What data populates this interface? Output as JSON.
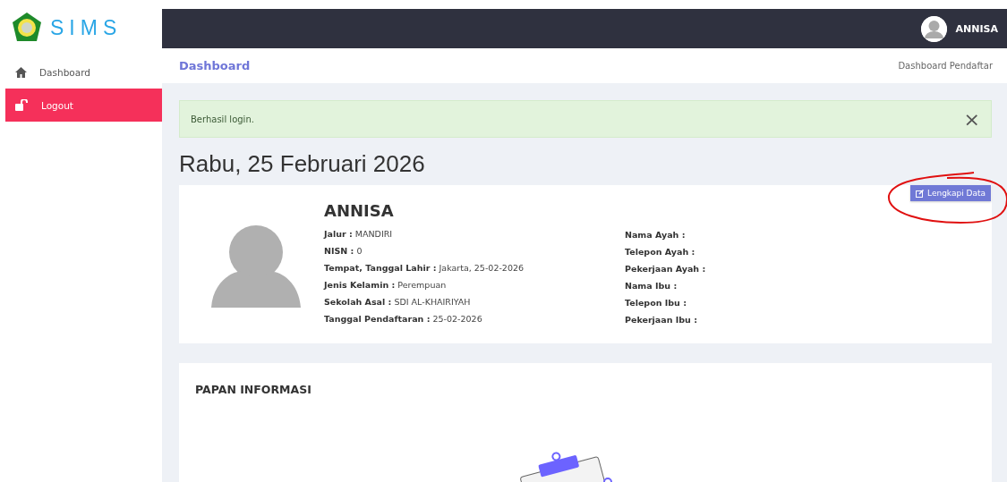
{
  "sidebar": {
    "brand": "SIMS",
    "items": [
      {
        "label": "Dashboard",
        "selected": false
      },
      {
        "label": "Logout",
        "selected": true
      }
    ]
  },
  "topbar": {
    "user": "ANNISA"
  },
  "breadcrumb": {
    "title": "Dashboard",
    "trail": "Dashboard Pendaftar"
  },
  "alert": {
    "message": "Berhasil login.",
    "close": "×"
  },
  "date_heading": "Rabu, 25 Februari 2026",
  "profile": {
    "name": "ANNISA",
    "button": "Lengkapi Data",
    "left_fields": [
      {
        "label": "Jalur :",
        "value": "MANDIRI"
      },
      {
        "label": "NISN :",
        "value": "0"
      },
      {
        "label": "Tempat, Tanggal Lahir :",
        "value": "Jakarta, 25-02-2026"
      },
      {
        "label": "Jenis Kelamin :",
        "value": "Perempuan"
      },
      {
        "label": "Sekolah Asal :",
        "value": "SDI AL-KHAIRIYAH"
      },
      {
        "label": "Tanggal Pendaftaran :",
        "value": "25-02-2026"
      }
    ],
    "right_fields": [
      {
        "label": "Nama Ayah :"
      },
      {
        "label": "Telepon Ayah :"
      },
      {
        "label": "Pekerjaan Ayah :"
      },
      {
        "label": "Nama Ibu :"
      },
      {
        "label": "Telepon Ibu :"
      },
      {
        "label": "Pekerjaan Ibu :"
      }
    ]
  },
  "info_board": {
    "title": "PAPAN INFORMASI"
  }
}
